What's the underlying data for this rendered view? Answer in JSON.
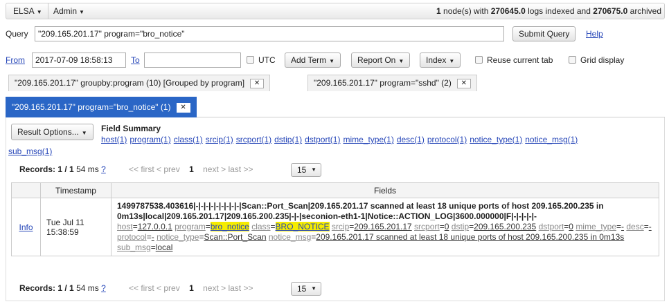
{
  "topbar": {
    "menus": [
      "ELSA",
      "Admin"
    ],
    "status": {
      "nodes": "1",
      "nodes_text": "node(s) with",
      "logs_indexed": "270645.0",
      "logs_indexed_text": "logs indexed and",
      "archived": "270675.0",
      "archived_text": "archived"
    }
  },
  "query": {
    "label": "Query",
    "value": "\"209.165.201.17\" program=\"bro_notice\"",
    "submit_label": "Submit Query",
    "help_label": "Help"
  },
  "time_row": {
    "from_label": "From",
    "from_value": "2017-07-09 18:58:13",
    "to_label": "To",
    "to_value": "",
    "utc_label": "UTC",
    "add_term_label": "Add Term",
    "report_on_label": "Report On",
    "index_label": "Index",
    "reuse_tab_label": "Reuse current tab",
    "grid_display_label": "Grid display"
  },
  "tabs": [
    {
      "label": "\"209.165.201.17\" groupby:program (10) [Grouped by program]",
      "close": "✕",
      "active": false
    },
    {
      "label": "\"209.165.201.17\" program=\"sshd\" (2)",
      "close": "✕",
      "active": false
    },
    {
      "label": "\"209.165.201.17\" program=\"bro_notice\" (1)",
      "close": "✕",
      "active": true
    }
  ],
  "result_options_label": "Result Options...",
  "field_summary": {
    "title": "Field Summary",
    "links": [
      "host(1)",
      "program(1)",
      "class(1)",
      "srcip(1)",
      "srcport(1)",
      "dstip(1)",
      "dstport(1)",
      "mime_type(1)",
      "desc(1)",
      "protocol(1)",
      "notice_type(1)",
      "notice_msg(1)"
    ],
    "last_link": "sub_msg(1)"
  },
  "records": {
    "label": "Records:",
    "count": "1 / 1",
    "time": "54 ms",
    "help": "?",
    "first": "<< first",
    "prev": "< prev",
    "page": "1",
    "next": "next >",
    "last": "last >>",
    "per_page": "15"
  },
  "table": {
    "headers": [
      "",
      "Timestamp",
      "Fields"
    ],
    "row": {
      "info": "Info",
      "timestamp_line1": "Tue Jul 11",
      "timestamp_line2": "15:38:59",
      "message": "1499787538.403616|-|-|-|-|-|-|-|-|-|Scan::Port_Scan|209.165.201.17 scanned at least 18 unique ports of host 209.165.200.235 in 0m13s|local|209.165.201.17|209.165.200.235|-|-|seconion-eth1-1|Notice::ACTION_LOG|3600.000000|F|-|-|-|-|-",
      "fields": [
        {
          "k": "host",
          "v": "127.0.0.1",
          "hl": false
        },
        {
          "k": "program",
          "v": "bro_notice",
          "hl": true
        },
        {
          "k": "class",
          "v": "BRO_NOTICE",
          "hl": true
        },
        {
          "k": "srcip",
          "v": "209.165.201.17",
          "hl": false
        },
        {
          "k": "srcport",
          "v": "0",
          "hl": false
        },
        {
          "k": "dstip",
          "v": "209.165.200.235",
          "hl": false
        },
        {
          "k": "dstport",
          "v": "0",
          "hl": false
        },
        {
          "k": "mime_type",
          "v": "-",
          "hl": false
        },
        {
          "k": "desc",
          "v": "-",
          "hl": false
        },
        {
          "k": "protocol",
          "v": "-",
          "hl": false
        },
        {
          "k": "notice_type",
          "v": "Scan::Port_Scan",
          "hl": false
        },
        {
          "k": "notice_msg",
          "v": "209.165.201.17 scanned at least 18 unique ports of host 209.165.200.235 in 0m13s",
          "hl": false
        },
        {
          "k": "sub_msg",
          "v": "local",
          "hl": false
        }
      ]
    }
  },
  "colors": {
    "active_tab": "#2a66c6",
    "link": "#2646b8",
    "highlight": "#f5ec00"
  }
}
